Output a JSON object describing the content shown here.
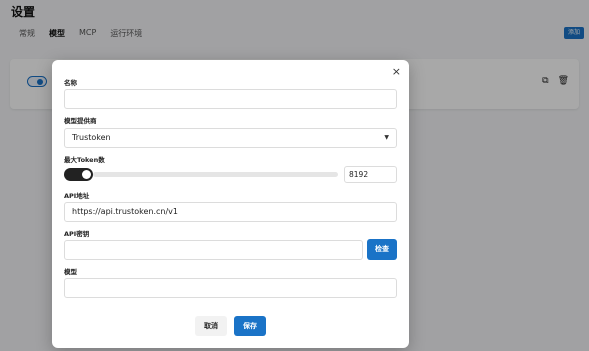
{
  "page": {
    "title": "设置",
    "tabs": [
      "常规",
      "模型",
      "MCP",
      "运行环境"
    ],
    "active_tab": "模型",
    "add_button": "添加",
    "card_icons": [
      "copy-icon",
      "trash-icon"
    ]
  },
  "dialog": {
    "close_glyph": "×",
    "name": {
      "label": "名称",
      "value": ""
    },
    "provider": {
      "label": "模型提供商",
      "value": "Trustoken",
      "arrow": "▼"
    },
    "max_tokens": {
      "label": "最大Token数",
      "value": "8192"
    },
    "api_url": {
      "label": "API地址",
      "value": "https://api.trustoken.cn/v1"
    },
    "api_key": {
      "label": "API密钥",
      "value": "",
      "check_button": "检查"
    },
    "model": {
      "label": "模型",
      "value": ""
    },
    "cancel_button": "取消",
    "save_button": "保存"
  },
  "colors": {
    "accent": "#1a73c7",
    "overlay": "rgba(0,0,0,0.34)"
  }
}
